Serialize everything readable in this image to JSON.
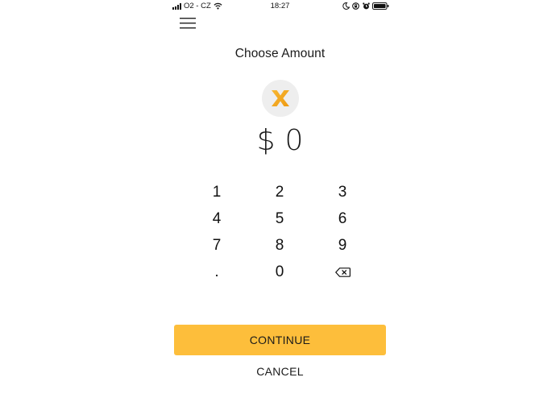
{
  "status_bar": {
    "carrier": "O2 - CZ",
    "time": "18:27",
    "icons": [
      "signal-icon",
      "wifi-icon",
      "moon-icon",
      "rotation-lock-icon",
      "alarm-icon",
      "battery-icon"
    ]
  },
  "header": {
    "menu_icon": "hamburger-menu-icon",
    "title": "Choose Amount"
  },
  "coin": {
    "icon": "x-coin-icon",
    "color": "#f2a71b",
    "background": "#eeeeee"
  },
  "amount": {
    "currency": "$",
    "value": "0"
  },
  "keypad": {
    "keys": [
      "1",
      "2",
      "3",
      "4",
      "5",
      "6",
      "7",
      "8",
      "9",
      ".",
      "0"
    ],
    "backspace_icon": "backspace-icon"
  },
  "actions": {
    "continue_label": "CONTINUE",
    "cancel_label": "CANCEL",
    "accent_color": "#fdbe3b"
  }
}
